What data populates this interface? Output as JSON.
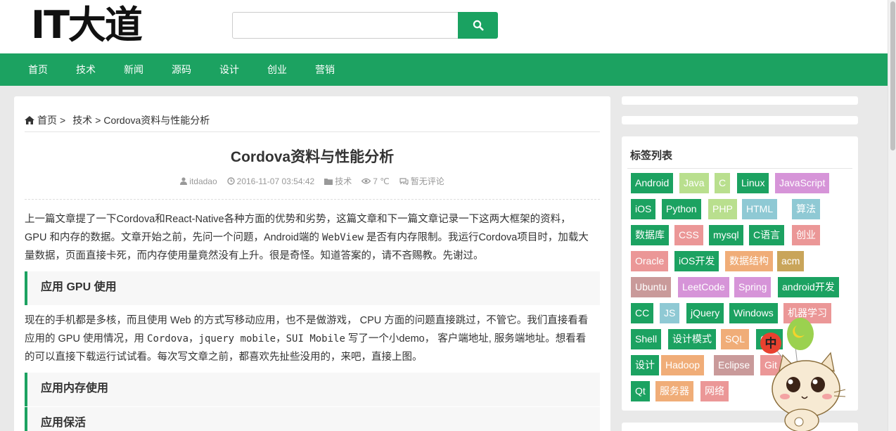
{
  "site": {
    "logo": "IT大道"
  },
  "search": {
    "placeholder": ""
  },
  "nav": {
    "items": [
      "首页",
      "技术",
      "新闻",
      "源码",
      "设计",
      "创业",
      "营销"
    ]
  },
  "breadcrumb": {
    "home": "首页",
    "sep1": ">",
    "category": "技术",
    "sep2": ">",
    "current": "Cordova资料与性能分析"
  },
  "article": {
    "title": "Cordova资料与性能分析",
    "meta": {
      "author": "itdadao",
      "date": "2016-11-07 03:54:42",
      "category": "技术",
      "views": "7 ℃",
      "comments": "暂无评论"
    },
    "p1": {
      "a": "上一篇文章提了一下Cordova和React-Native各种方面的优势和劣势，这篇文章和下一篇文章记录一下这两大框架的资料，",
      "b": "GPU 和内存的数据。文章开始之前，先问一个问题，Android端的 ",
      "c": "WebView",
      "d": " 是否有内存限制。我运行Cordova项目时，加载大",
      "e": "量数据，页面直接卡死，而内存使用量竟然没有上升。很是奇怪。知道答案的，请不吝赐教。先谢过。"
    },
    "h1": "应用 GPU 使用",
    "p2": {
      "a": "现在的手机都是多核，而且使用 Web 的方式写移动应用，也不是做游戏， CPU 方面的问题直接跳过，不管它。我们直接看看",
      "b": "应用的 GPU 使用情况，用 ",
      "c": "Cordova",
      "d": "，",
      "e": "jquery mobile",
      "f": "，",
      "g": "SUI Mobile",
      "h": " 写了一个小demo， 客户端地址, 服务端地址。想看看",
      "i": "的可以直接下载运行试试看。每次写文章之前，都喜欢先扯些没用的，来吧，直接上图。"
    },
    "h2": "应用内存使用",
    "h3": "应用保活"
  },
  "sidebar": {
    "tags_title": "标签列表",
    "tags": [
      "Android",
      "Java",
      "C",
      "Linux",
      "JavaScript",
      "iOS",
      "Python",
      "PHP",
      "HTML",
      "算法",
      "数据库",
      "CSS",
      "mysql",
      "C语言",
      "创业",
      "Oracle",
      "iOS开发",
      "数据结构",
      "acm",
      "Ubuntu",
      "LeetCode",
      "Spring",
      "android开发",
      "CC",
      "JS",
      "jQuery",
      "Windows",
      "机器学习",
      "Shell",
      "设计模式",
      "SQL",
      "C++",
      "设计",
      "Hadoop",
      "Eclipse",
      "Git",
      "Qt",
      "服务器",
      "网络"
    ],
    "mascot_badge": "中"
  },
  "colors": {
    "accent": "#1ca261"
  }
}
